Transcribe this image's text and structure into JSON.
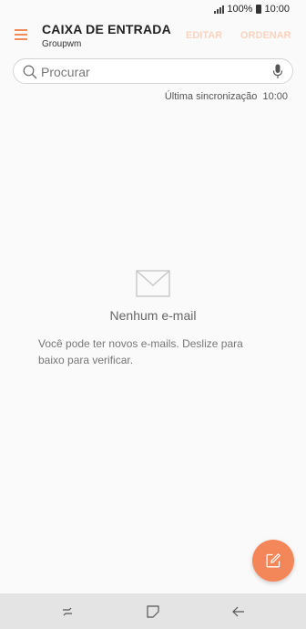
{
  "status_bar": {
    "battery": "100%",
    "time": "10:00"
  },
  "header": {
    "title": "CAIXA DE ENTRADA",
    "account": "Groupwm",
    "edit_label": "EDITAR",
    "sort_label": "ORDENAR"
  },
  "search": {
    "placeholder": "Procurar",
    "value": ""
  },
  "sync": {
    "label": "Última sincronização",
    "time": "10:00"
  },
  "empty_state": {
    "icon": "envelope-icon",
    "title": "Nenhum e-mail",
    "message": "Você pode ter novos e-mails. Deslize para baixo para verificar."
  },
  "fab": {
    "icon": "compose-icon"
  },
  "nav_bar": {
    "icons": [
      "recent-apps-icon",
      "home-icon",
      "back-icon"
    ]
  },
  "colors": {
    "accent": "#f4875a",
    "header_action_disabled": "#fbd3be",
    "nav_bar_bg": "#e4e4e4",
    "background": "#fafafa"
  }
}
